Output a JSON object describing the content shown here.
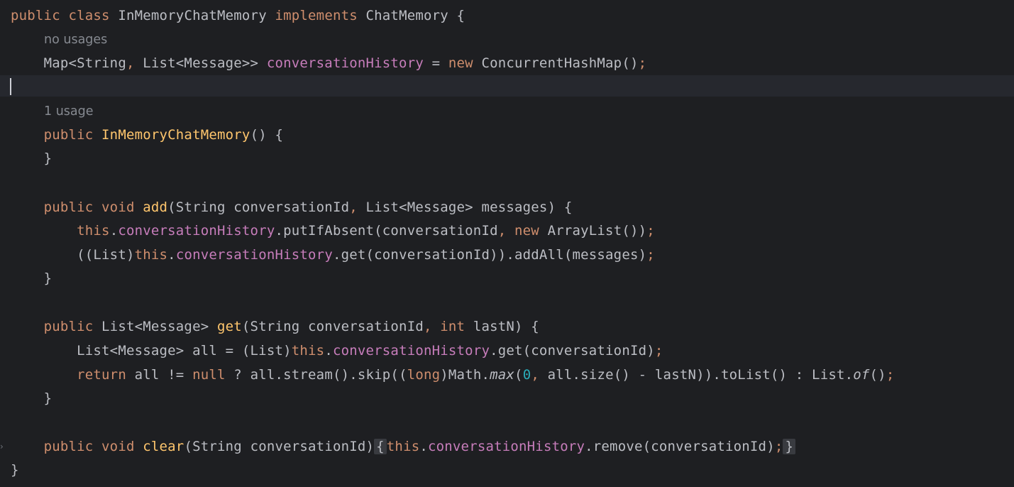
{
  "editor": {
    "language": "Java",
    "colors": {
      "background": "#1e1f22",
      "current_line": "#26282e",
      "default_text": "#bcbec4",
      "keyword": "#cf8e6d",
      "field": "#c77dbb",
      "method_declaration": "#ffc66d",
      "number": "#2aacb8",
      "inlay_hint": "#868a91",
      "folded_region": "#393b40"
    },
    "hints": {
      "field_usages": "no usages",
      "constructor_usages": "1 usage"
    },
    "lines": {
      "class_decl": {
        "public": "public",
        "class": "class",
        "name": "InMemoryChatMemory",
        "implements": "implements",
        "iface": "ChatMemory {"
      },
      "field_decl": {
        "type": "Map<String",
        "comma": ",",
        "type2": " List<Message>> ",
        "field": "conversationHistory",
        "eq": " = ",
        "new": "new",
        "rest": " ConcurrentHashMap()",
        "semi": ";"
      },
      "ctor_decl": {
        "public": "public",
        "name": "InMemoryChatMemory",
        "rest": "() {"
      },
      "ctor_close": "}",
      "add_decl": {
        "public": "public",
        "void": "void",
        "name": "add",
        "p1": "(String conversationId",
        "comma": ",",
        "p2": " List<Message> messages) {"
      },
      "add_body1": {
        "this": "this",
        "dot": ".",
        "field": "conversationHistory",
        "call": ".putIfAbsent(conversationId",
        "comma": ",",
        "new": "new",
        "rest": " ArrayList())",
        "semi": ";"
      },
      "add_body2": {
        "cast": "((List)",
        "this": "this",
        "dot": ".",
        "field": "conversationHistory",
        "rest": ".get(conversationId)).addAll(messages)",
        "semi": ";"
      },
      "add_close": "}",
      "get_decl": {
        "public": "public",
        "type": " List<Message> ",
        "name": "get",
        "p1": "(String conversationId",
        "comma": ",",
        "int": "int",
        "p2": " lastN) {"
      },
      "get_body1": {
        "pre": "List<Message> all = (List)",
        "this": "this",
        "dot": ".",
        "field": "conversationHistory",
        "rest": ".get(conversationId)",
        "semi": ";"
      },
      "get_body2": {
        "return": "return",
        "a": " all != ",
        "null": "null",
        "b": " ? all.stream().skip((",
        "long": "long",
        "c": ")Math.",
        "max": "max",
        "d": "(",
        "zero": "0",
        "comma": ",",
        "e": " all.size() - lastN)).toList() : List.",
        "of": "of",
        "f": "()",
        "semi": ";"
      },
      "get_close": "}",
      "clear_decl": {
        "public": "public",
        "void": "void",
        "name": "clear",
        "params": "(String conversationId)",
        "open": "{",
        "this": "this",
        "dot": ".",
        "field": "conversationHistory",
        "rest": ".remove(conversationId)",
        "semi": ";",
        "close": "}"
      },
      "class_close": "}"
    }
  }
}
